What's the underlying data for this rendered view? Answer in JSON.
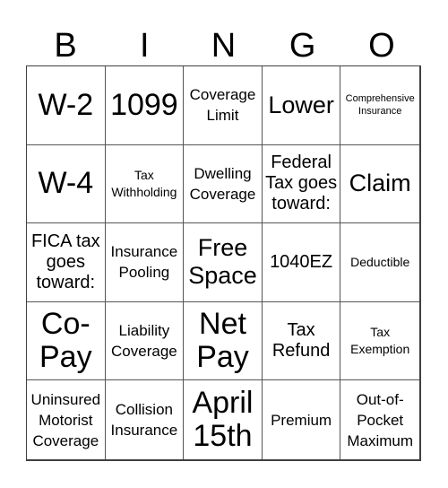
{
  "header": {
    "letters": [
      "B",
      "I",
      "N",
      "G",
      "O"
    ]
  },
  "cells": [
    {
      "text": "W-2",
      "size": "w"
    },
    {
      "text": "1099",
      "size": "w"
    },
    {
      "text": "Coverage\nLimit",
      "size": "sm"
    },
    {
      "text": "Lower",
      "size": "lg"
    },
    {
      "text": "Comprehensive\nInsurance",
      "size": "xxs"
    },
    {
      "text": "W-4",
      "size": "w"
    },
    {
      "text": "Tax\nWithholding",
      "size": "xs"
    },
    {
      "text": "Dwelling\nCoverage",
      "size": "sm"
    },
    {
      "text": "Federal\nTax goes\ntoward:",
      "size": "md"
    },
    {
      "text": "Claim",
      "size": "lg"
    },
    {
      "text": "FICA tax\ngoes\ntoward:",
      "size": "md"
    },
    {
      "text": "Insurance\nPooling",
      "size": "sm"
    },
    {
      "text": "Free\nSpace",
      "size": "lg"
    },
    {
      "text": "1040EZ",
      "size": "md"
    },
    {
      "text": "Deductible",
      "size": "xs"
    },
    {
      "text": "Co-\nPay",
      "size": "xl"
    },
    {
      "text": "Liability\nCoverage",
      "size": "sm"
    },
    {
      "text": "Net\nPay",
      "size": "xl"
    },
    {
      "text": "Tax\nRefund",
      "size": "md"
    },
    {
      "text": "Tax\nExemption",
      "size": "xs"
    },
    {
      "text": "Uninsured\nMotorist\nCoverage",
      "size": "sm"
    },
    {
      "text": "Collision\nInsurance",
      "size": "sm"
    },
    {
      "text": "April\n15th",
      "size": "xl"
    },
    {
      "text": "Premium",
      "size": "sm"
    },
    {
      "text": "Out-of-\nPocket\nMaximum",
      "size": "sm"
    }
  ]
}
